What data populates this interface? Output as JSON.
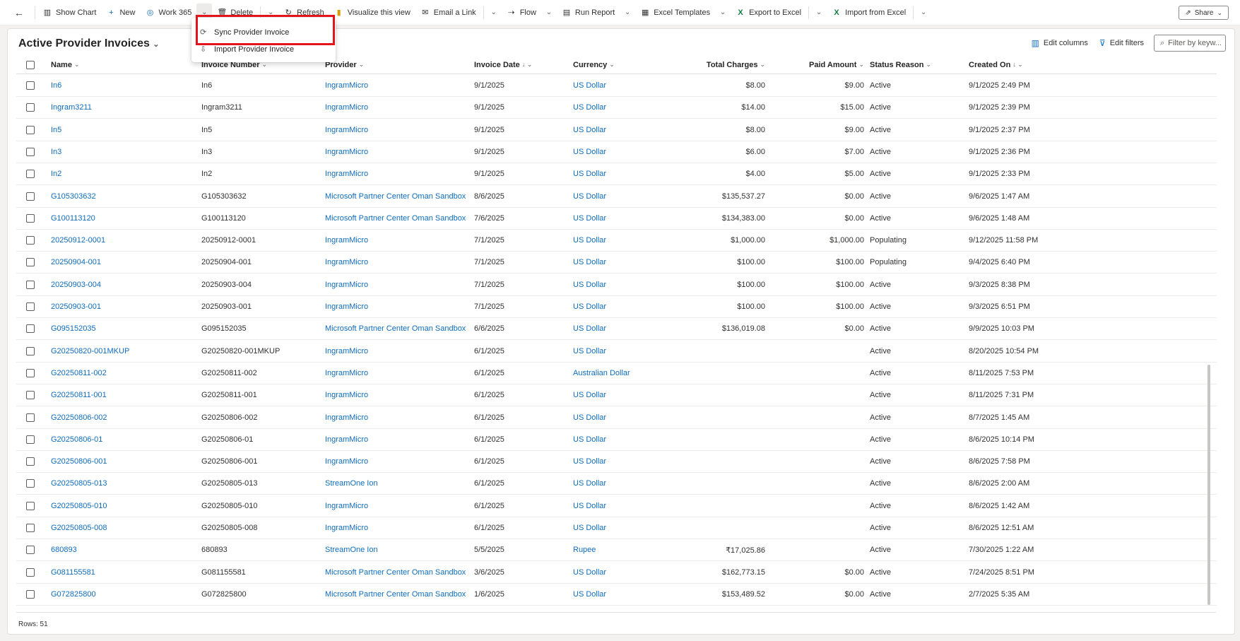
{
  "toolbar": {
    "back_icon": "back-arrow-icon",
    "items": [
      {
        "label": "Show Chart",
        "icon": "chart-icon"
      },
      {
        "label": "New",
        "icon": "plus-icon"
      },
      {
        "label": "Work 365",
        "icon": "work365-logo-icon"
      },
      {
        "label": "Delete",
        "icon": "trash-icon"
      },
      {
        "label": "Refresh",
        "icon": "refresh-icon"
      },
      {
        "label": "Visualize this view",
        "icon": "powerbi-icon"
      },
      {
        "label": "Email a Link",
        "icon": "mail-icon"
      },
      {
        "label": "Flow",
        "icon": "flow-icon"
      },
      {
        "label": "Run Report",
        "icon": "report-icon"
      },
      {
        "label": "Excel Templates",
        "icon": "excel-template-icon"
      },
      {
        "label": "Export to Excel",
        "icon": "excel-icon"
      },
      {
        "label": "Import from Excel",
        "icon": "excel-import-icon"
      }
    ],
    "share_label": "Share"
  },
  "dropdown": {
    "items": [
      {
        "label": "Sync Provider Invoice",
        "icon": "sync-icon"
      },
      {
        "label": "Import Provider Invoice",
        "icon": "import-icon"
      }
    ]
  },
  "view": {
    "title": "Active Provider Invoices",
    "edit_columns": "Edit columns",
    "edit_filters": "Edit filters",
    "filter_placeholder": "Filter by keyw...",
    "rows_label": "Rows: 51"
  },
  "columns": [
    {
      "label": "Name",
      "sort": "⌄"
    },
    {
      "label": "Invoice Number",
      "sort": "⌄"
    },
    {
      "label": "Provider",
      "sort": "⌄"
    },
    {
      "label": "Invoice Date",
      "sort": "↓ ⌄"
    },
    {
      "label": "Currency",
      "sort": "⌄"
    },
    {
      "label": "Total Charges",
      "sort": "⌄"
    },
    {
      "label": "Paid Amount",
      "sort": "⌄"
    },
    {
      "label": "Status Reason",
      "sort": "⌄"
    },
    {
      "label": "Created On",
      "sort": "↓ ⌄"
    }
  ],
  "rows": [
    {
      "name": "In6",
      "number": "In6",
      "provider": "IngramMicro",
      "date": "9/1/2025",
      "currency": "US Dollar",
      "total": "$8.00",
      "paid": "$9.00",
      "status": "Active",
      "created": "9/1/2025 2:49 PM"
    },
    {
      "name": "Ingram3211",
      "number": "Ingram3211",
      "provider": "IngramMicro",
      "date": "9/1/2025",
      "currency": "US Dollar",
      "total": "$14.00",
      "paid": "$15.00",
      "status": "Active",
      "created": "9/1/2025 2:39 PM"
    },
    {
      "name": "In5",
      "number": "In5",
      "provider": "IngramMicro",
      "date": "9/1/2025",
      "currency": "US Dollar",
      "total": "$8.00",
      "paid": "$9.00",
      "status": "Active",
      "created": "9/1/2025 2:37 PM"
    },
    {
      "name": "In3",
      "number": "In3",
      "provider": "IngramMicro",
      "date": "9/1/2025",
      "currency": "US Dollar",
      "total": "$6.00",
      "paid": "$7.00",
      "status": "Active",
      "created": "9/1/2025 2:36 PM"
    },
    {
      "name": "In2",
      "number": "In2",
      "provider": "IngramMicro",
      "date": "9/1/2025",
      "currency": "US Dollar",
      "total": "$4.00",
      "paid": "$5.00",
      "status": "Active",
      "created": "9/1/2025 2:33 PM"
    },
    {
      "name": "G105303632",
      "number": "G105303632",
      "provider": "Microsoft Partner Center Oman Sandbox",
      "date": "8/6/2025",
      "currency": "US Dollar",
      "total": "$135,537.27",
      "paid": "$0.00",
      "status": "Active",
      "created": "9/6/2025 1:47 AM"
    },
    {
      "name": "G100113120",
      "number": "G100113120",
      "provider": "Microsoft Partner Center Oman Sandbox",
      "date": "7/6/2025",
      "currency": "US Dollar",
      "total": "$134,383.00",
      "paid": "$0.00",
      "status": "Active",
      "created": "9/6/2025 1:48 AM"
    },
    {
      "name": "20250912-0001",
      "number": "20250912-0001",
      "provider": "IngramMicro",
      "date": "7/1/2025",
      "currency": "US Dollar",
      "total": "$1,000.00",
      "paid": "$1,000.00",
      "status": "Populating",
      "created": "9/12/2025 11:58 PM"
    },
    {
      "name": "20250904-001",
      "number": "20250904-001",
      "provider": "IngramMicro",
      "date": "7/1/2025",
      "currency": "US Dollar",
      "total": "$100.00",
      "paid": "$100.00",
      "status": "Populating",
      "created": "9/4/2025 6:40 PM"
    },
    {
      "name": "20250903-004",
      "number": "20250903-004",
      "provider": "IngramMicro",
      "date": "7/1/2025",
      "currency": "US Dollar",
      "total": "$100.00",
      "paid": "$100.00",
      "status": "Active",
      "created": "9/3/2025 8:38 PM"
    },
    {
      "name": "20250903-001",
      "number": "20250903-001",
      "provider": "IngramMicro",
      "date": "7/1/2025",
      "currency": "US Dollar",
      "total": "$100.00",
      "paid": "$100.00",
      "status": "Active",
      "created": "9/3/2025 6:51 PM"
    },
    {
      "name": "G095152035",
      "number": "G095152035",
      "provider": "Microsoft Partner Center Oman Sandbox",
      "date": "6/6/2025",
      "currency": "US Dollar",
      "total": "$136,019.08",
      "paid": "$0.00",
      "status": "Active",
      "created": "9/9/2025 10:03 PM"
    },
    {
      "name": "G20250820-001MKUP",
      "number": "G20250820-001MKUP",
      "provider": "IngramMicro",
      "date": "6/1/2025",
      "currency": "US Dollar",
      "total": "",
      "paid": "",
      "status": "Active",
      "created": "8/20/2025 10:54 PM"
    },
    {
      "name": "G20250811-002",
      "number": "G20250811-002",
      "provider": "IngramMicro",
      "date": "6/1/2025",
      "currency": "Australian Dollar",
      "total": "",
      "paid": "",
      "status": "Active",
      "created": "8/11/2025 7:53 PM"
    },
    {
      "name": "G20250811-001",
      "number": "G20250811-001",
      "provider": "IngramMicro",
      "date": "6/1/2025",
      "currency": "US Dollar",
      "total": "",
      "paid": "",
      "status": "Active",
      "created": "8/11/2025 7:31 PM"
    },
    {
      "name": "G20250806-002",
      "number": "G20250806-002",
      "provider": "IngramMicro",
      "date": "6/1/2025",
      "currency": "US Dollar",
      "total": "",
      "paid": "",
      "status": "Active",
      "created": "8/7/2025 1:45 AM"
    },
    {
      "name": "G20250806-01",
      "number": "G20250806-01",
      "provider": "IngramMicro",
      "date": "6/1/2025",
      "currency": "US Dollar",
      "total": "",
      "paid": "",
      "status": "Active",
      "created": "8/6/2025 10:14 PM"
    },
    {
      "name": "G20250806-001",
      "number": "G20250806-001",
      "provider": "IngramMicro",
      "date": "6/1/2025",
      "currency": "US Dollar",
      "total": "",
      "paid": "",
      "status": "Active",
      "created": "8/6/2025 7:58 PM"
    },
    {
      "name": "G20250805-013",
      "number": "G20250805-013",
      "provider": "StreamOne Ion",
      "date": "6/1/2025",
      "currency": "US Dollar",
      "total": "",
      "paid": "",
      "status": "Active",
      "created": "8/6/2025 2:00 AM"
    },
    {
      "name": "G20250805-010",
      "number": "G20250805-010",
      "provider": "IngramMicro",
      "date": "6/1/2025",
      "currency": "US Dollar",
      "total": "",
      "paid": "",
      "status": "Active",
      "created": "8/6/2025 1:42 AM"
    },
    {
      "name": "G20250805-008",
      "number": "G20250805-008",
      "provider": "IngramMicro",
      "date": "6/1/2025",
      "currency": "US Dollar",
      "total": "",
      "paid": "",
      "status": "Active",
      "created": "8/6/2025 12:51 AM"
    },
    {
      "name": "680893",
      "number": "680893",
      "provider": "StreamOne Ion",
      "date": "5/5/2025",
      "currency": "Rupee",
      "total": "₹17,025.86",
      "paid": "",
      "status": "Active",
      "created": "7/30/2025 1:22 AM"
    },
    {
      "name": "G081155581",
      "number": "G081155581",
      "provider": "Microsoft Partner Center Oman Sandbox",
      "date": "3/6/2025",
      "currency": "US Dollar",
      "total": "$162,773.15",
      "paid": "$0.00",
      "status": "Active",
      "created": "7/24/2025 8:51 PM"
    },
    {
      "name": "G072825800",
      "number": "G072825800",
      "provider": "Microsoft Partner Center Oman Sandbox",
      "date": "1/6/2025",
      "currency": "US Dollar",
      "total": "$153,489.52",
      "paid": "$0.00",
      "status": "Active",
      "created": "2/7/2025 5:35 AM"
    }
  ]
}
